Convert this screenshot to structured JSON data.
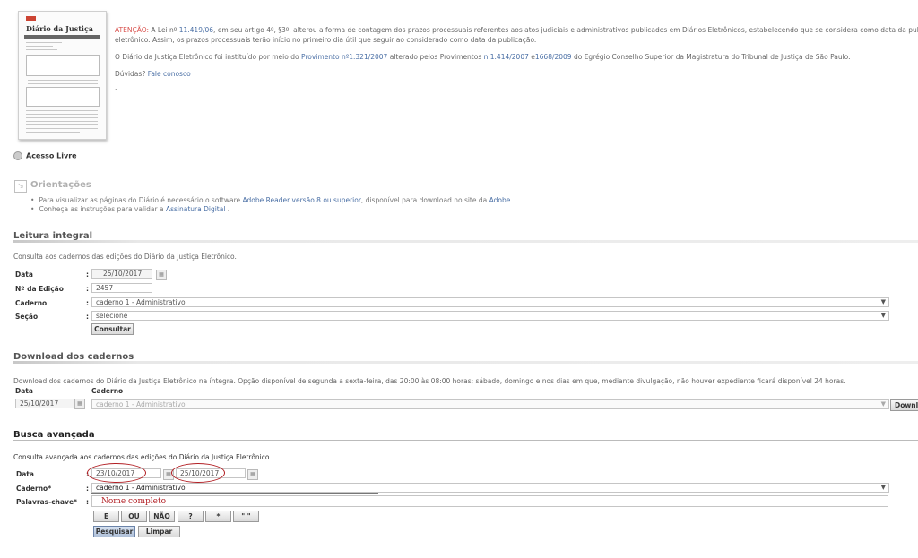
{
  "thumbnail": {
    "title": "Diário da Justiça"
  },
  "access": {
    "label": "Acesso Livre"
  },
  "notice": {
    "line1_red": "ATENÇÃO:",
    "line1_a": " A Lei nº ",
    "line1_link": "11.419/06",
    "line1_b": ", em seu artigo 4º, §3º, alterou a forma de contagem dos prazos processuais referentes aos atos judiciais e administrativos publicados em Diários Eletrônicos, estabelecendo que se considera como data da publicação",
    "line2": "eletrônico. Assim, os prazos processuais terão início no primeiro dia útil que seguir ao considerado como data da publicação.",
    "line3_a": "O Diário da Justiça Eletrônico foi instituído por meio do ",
    "line3_link1": "Provimento nº1.321/2007",
    "line3_b": " alterado pelos Provimentos ",
    "line3_link2": "n.1.414/2007",
    "line3_c": " e",
    "line3_link3": "1668/2009",
    "line3_d": " do Egrégio Conselho Superior da Magistratura do Tribunal de Justiça de São Paulo.",
    "doubts_a": "Dúvidas? ",
    "doubts_link": "Fale conosco",
    "dot": "."
  },
  "orientacoes": {
    "title": "Orientações",
    "item1_a": "Para visualizar as páginas do Diário é necessário o software ",
    "item1_link1": "Adobe Reader versão 8 ou superior",
    "item1_b": ", disponível para download no site da ",
    "item1_link2": "Adobe",
    "item1_c": ".",
    "item2_a": "Conheça as instruções para validar a ",
    "item2_link": "Assinatura Digital",
    "item2_b": " ."
  },
  "leitura": {
    "title": "Leitura integral",
    "subtitle": "Consulta aos cadernos das edições do Diário da Justiça Eletrônico.",
    "data_label": "Data",
    "data_value": "25/10/2017",
    "edicao_label": "Nº da Edição",
    "edicao_value": "2457",
    "caderno_label": "Caderno",
    "caderno_value": "caderno 1 - Administrativo",
    "secao_label": "Seção",
    "secao_value": "selecione",
    "button": "Consultar"
  },
  "download": {
    "title": "Download dos cadernos",
    "subtitle": "Download dos cadernos do Diário da Justiça Eletrônico na íntegra. Opção disponível de segunda a sexta-feira, das 20:00 às 08:00 horas; sábado, domingo e nos dias em que, mediante divulgação, não houver expediente ficará disponível 24 horas.",
    "data_label": "Data",
    "caderno_label": "Caderno",
    "data_value": "25/10/2017",
    "caderno_value": "caderno 1 - Administrativo",
    "button": "Download"
  },
  "busca": {
    "title": "Busca avançada",
    "subtitle": "Consulta avançada aos cadernos das edições do Diário da Justiça Eletrônico.",
    "data_label": "Data",
    "date_from": "23/10/2017",
    "date_to": "25/10/2017",
    "caderno_label": "Caderno*",
    "caderno_value": "caderno 1 - Administrativo",
    "palavras_label": "Palavras-chave*",
    "palavras_value": "Nome completo",
    "operators": [
      "E",
      "OU",
      "NÃO",
      "?",
      "*",
      "\" \""
    ],
    "search_button": "Pesquisar",
    "clear_button": "Limpar",
    "colon": ":"
  }
}
